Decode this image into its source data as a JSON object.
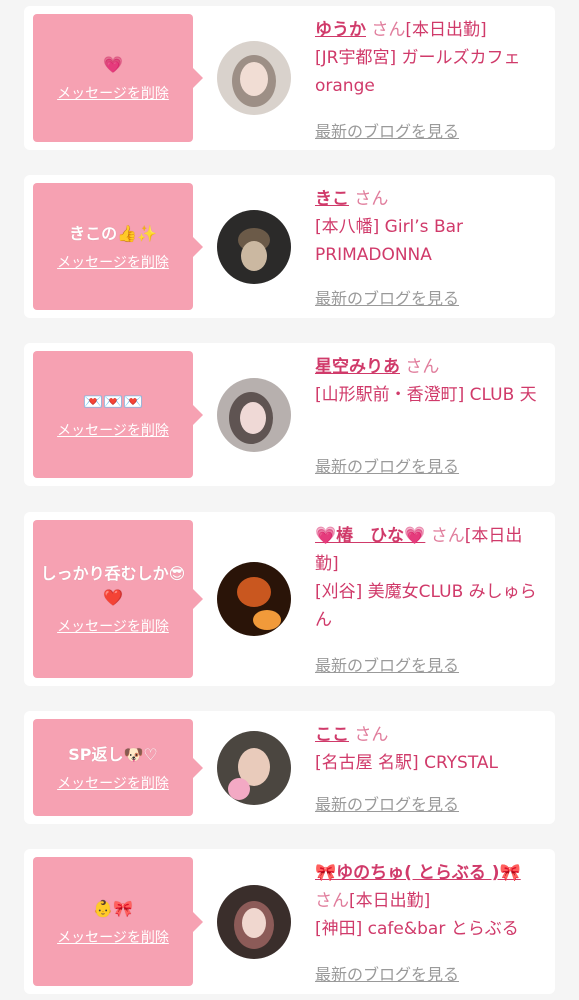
{
  "common": {
    "delete_label": "メッセージを削除",
    "blog_label": "最新のブログを見る"
  },
  "cards": [
    {
      "message": "💗",
      "name": "ゆうか",
      "honorific": "さん",
      "status": "[本日出勤]",
      "shop": "[JR宇都宮] ガールズカフェ orange",
      "avatar_colors": [
        "#d9d2cc",
        "#f1ddd4",
        "#9d8f86"
      ]
    },
    {
      "message": "きこの👍✨",
      "name": "きこ",
      "honorific": "さん",
      "status": "",
      "shop": "[本八幡] Girl’s Bar PRIMADONNA",
      "avatar_colors": [
        "#2b2a29",
        "#cbb8a1",
        "#6b5a48"
      ]
    },
    {
      "message": "💌💌💌",
      "name": "星空みりあ",
      "honorific": "さん",
      "status": "",
      "shop": "[山形駅前・香澄町] CLUB 天",
      "avatar_colors": [
        "#b7b0ae",
        "#efd9d6",
        "#5f5452"
      ]
    },
    {
      "message": "しっかり呑むしか😎❤️",
      "name": "💗椿　ひな💗",
      "honorific": "さん",
      "status": "[本日出勤]",
      "shop": "[刈谷] 美魔女CLUB みしゅらん",
      "avatar_colors": [
        "#2a1408",
        "#c9571f",
        "#f19a3a"
      ]
    },
    {
      "message": "SP返し🐶♡",
      "name": "ここ",
      "honorific": "さん",
      "status": "",
      "shop": "[名古屋 名駅] CRYSTAL",
      "avatar_colors": [
        "#4b4640",
        "#e9cbbb",
        "#f3a9c4"
      ]
    },
    {
      "message": "👶🎀",
      "name": "🎀ゆのちゅ( とらぶる )🎀",
      "honorific": "さん",
      "status": "[本日出勤]",
      "shop": "[神田] cafe&bar とらぶる",
      "avatar_colors": [
        "#3a2e2b",
        "#f0d7cf",
        "#8c5b58"
      ]
    }
  ]
}
